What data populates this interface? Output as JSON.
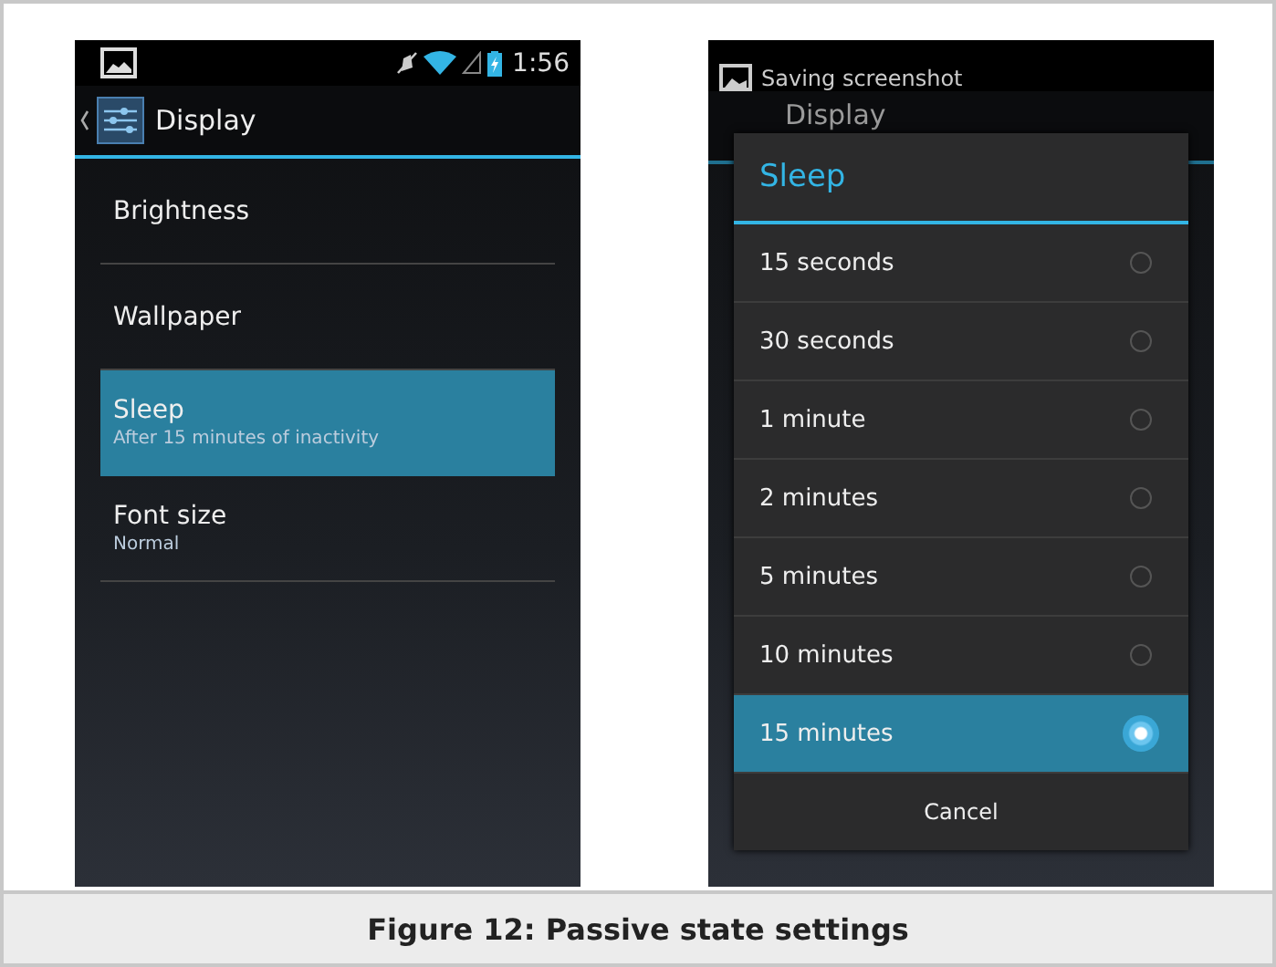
{
  "left_phone": {
    "status_bar": {
      "time": "1:56"
    },
    "action_bar": {
      "title": "Display"
    },
    "items": [
      {
        "title": "Brightness",
        "selected": false
      },
      {
        "title": "Wallpaper",
        "selected": false
      },
      {
        "title": "Sleep",
        "summary": "After 15 minutes of inactivity",
        "selected": true
      },
      {
        "title": "Font size",
        "summary": "Normal",
        "selected": false
      }
    ]
  },
  "right_phone": {
    "notification": "Saving screenshot",
    "action_bar": {
      "title": "Display"
    },
    "dialog": {
      "title": "Sleep",
      "options": [
        {
          "label": "15 seconds",
          "selected": false
        },
        {
          "label": "30 seconds",
          "selected": false
        },
        {
          "label": "1 minute",
          "selected": false
        },
        {
          "label": "2 minutes",
          "selected": false
        },
        {
          "label": "5 minutes",
          "selected": false
        },
        {
          "label": "10 minutes",
          "selected": false
        },
        {
          "label": "15 minutes",
          "selected": true
        }
      ],
      "button": "Cancel"
    }
  },
  "caption": "Figure 12: Passive state settings"
}
